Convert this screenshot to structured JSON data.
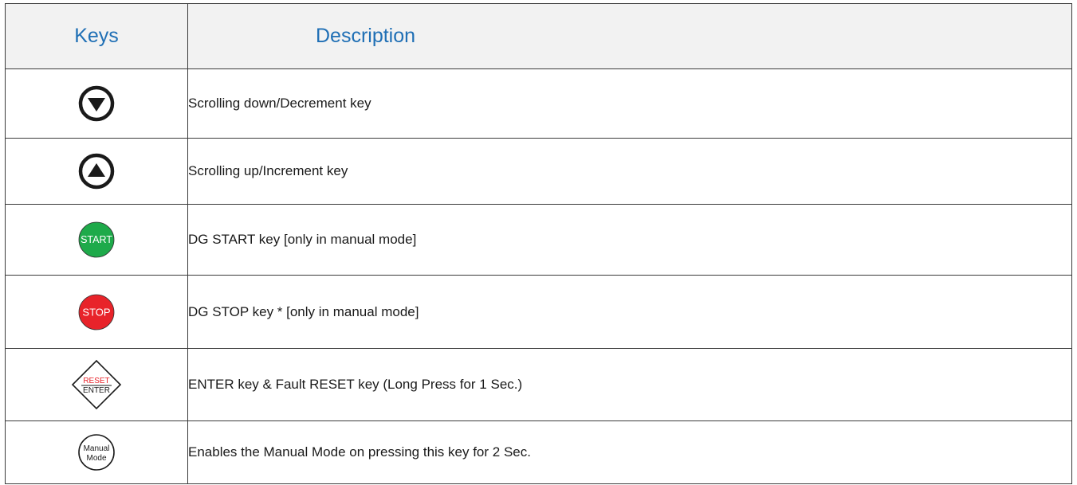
{
  "header": {
    "keys_label": "Keys",
    "description_label": "Description"
  },
  "rows": [
    {
      "icon": "down-arrow-circle-icon",
      "icon_text": "",
      "description": "Scrolling down/Decrement key"
    },
    {
      "icon": "up-arrow-circle-icon",
      "icon_text": "",
      "description": "Scrolling up/Increment key"
    },
    {
      "icon": "start-button-icon",
      "icon_text": "START",
      "description": "DG START key [only in manual mode]"
    },
    {
      "icon": "stop-button-icon",
      "icon_text": "STOP",
      "description": "DG STOP key * [only in manual mode]"
    },
    {
      "icon": "reset-enter-diamond-icon",
      "icon_text_top": "RESET",
      "icon_text_bottom": "ENTER",
      "description": "ENTER key & Fault RESET key (Long Press for 1 Sec.)"
    },
    {
      "icon": "manual-mode-circle-icon",
      "icon_text_top": "Manual",
      "icon_text_bottom": "Mode",
      "description": "Enables the Manual Mode on pressing this key for 2 Sec."
    }
  ],
  "colors": {
    "header_text": "#1f6fb5",
    "header_bg": "#f2f2f2",
    "start_green": "#1eaa4a",
    "stop_red": "#e8232a",
    "reset_red": "#e8232a"
  }
}
